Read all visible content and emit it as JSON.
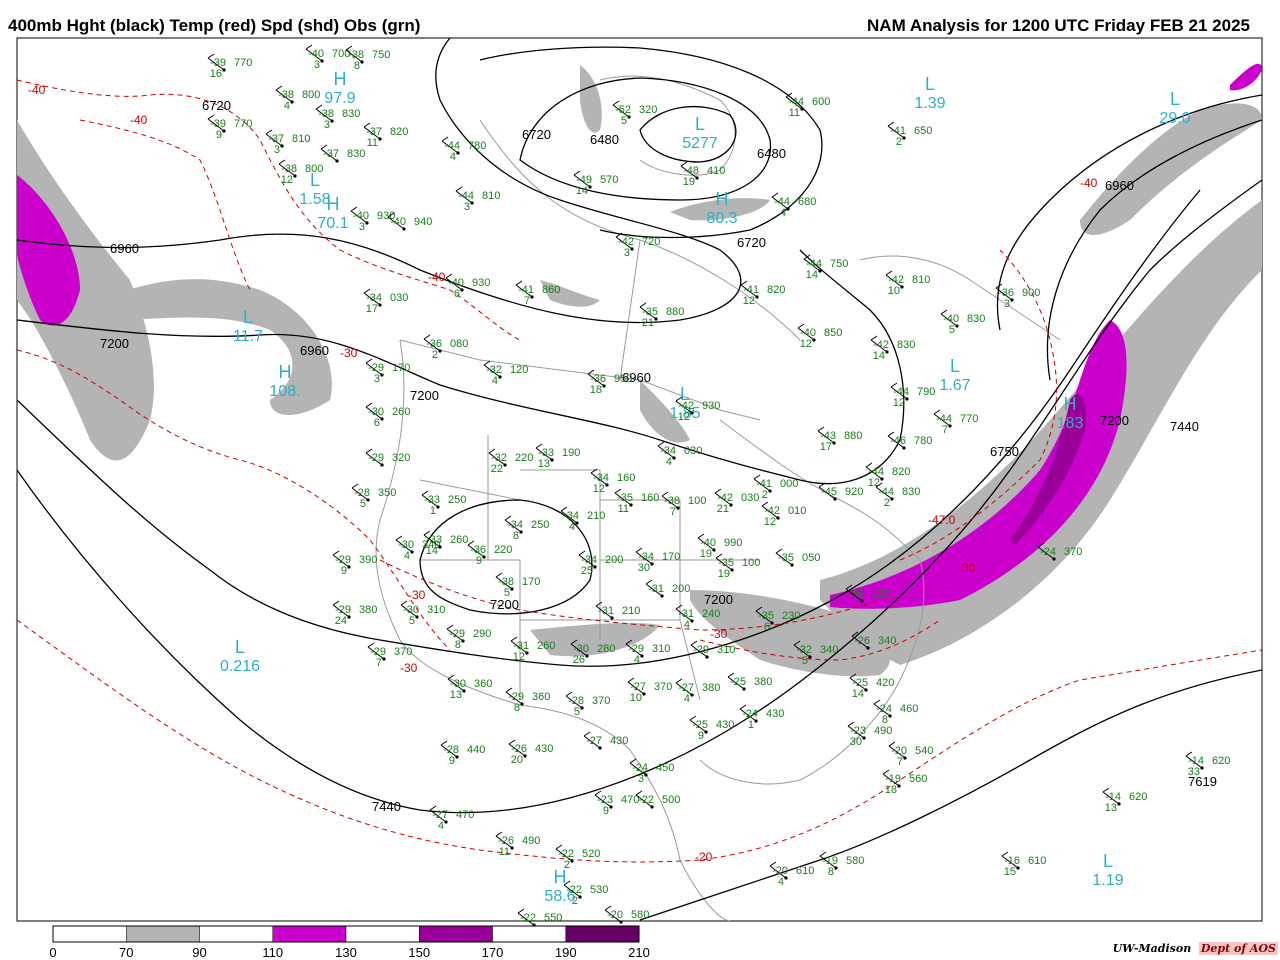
{
  "header": {
    "left": "400mb Hght (black) Temp (red) Spd (shd) Obs (grn)",
    "right": "NAM Analysis for 1200 UTC Friday  FEB 21 2025"
  },
  "legend": {
    "ticks": [
      "0",
      "70",
      "90",
      "110",
      "130",
      "150",
      "170",
      "190",
      "210"
    ],
    "colors": [
      "#ffffff",
      "#b4b4b4",
      "#ffffff",
      "#cc00cc",
      "#ffffff",
      "#990099",
      "#ffffff",
      "#660066"
    ]
  },
  "credit": {
    "text": "UW-Madison",
    "dept": "Dept of AOS"
  },
  "height_labels": [
    "6720",
    "6720",
    "6480",
    "6480",
    "6720",
    "6960",
    "6960",
    "7200",
    "6960",
    "6960",
    "7200",
    "7200",
    "7200",
    "7440",
    "7440",
    "7200",
    "6750",
    "7619"
  ],
  "temp_labels": [
    "-40",
    "-40",
    "-40",
    "-30",
    "-40",
    "-30",
    "-30",
    "-30",
    "-20",
    "-30",
    "-47.0"
  ],
  "centers": [
    {
      "letter": "H",
      "value": "97.9"
    },
    {
      "letter": "L",
      "value": "1.58"
    },
    {
      "letter": "H",
      "value": "70.1"
    },
    {
      "letter": "L",
      "value": "11.7"
    },
    {
      "letter": "H",
      "value": "108."
    },
    {
      "letter": "L",
      "value": "0.216"
    },
    {
      "letter": "H",
      "value": "80.3"
    },
    {
      "letter": "L",
      "value": "5277"
    },
    {
      "letter": "L",
      "value": "1.39"
    },
    {
      "letter": "L",
      "value": "29.0"
    },
    {
      "letter": "L",
      "value": "1.85"
    },
    {
      "letter": "H",
      "value": "183"
    },
    {
      "letter": "L",
      "value": "1.19"
    },
    {
      "letter": "H",
      "value": "58.6"
    },
    {
      "letter": "L",
      "value": "1.67"
    }
  ],
  "observations": [
    {
      "t": "-39",
      "h": "770",
      "d": "16"
    },
    {
      "t": "-40",
      "h": "700",
      "d": "3"
    },
    {
      "t": "-38",
      "h": "750",
      "d": "8"
    },
    {
      "t": "-38",
      "h": "800",
      "d": "4"
    },
    {
      "t": "-39",
      "h": "770",
      "d": "9"
    },
    {
      "t": "-38",
      "h": "830",
      "d": "3"
    },
    {
      "t": "-37",
      "h": "810",
      "d": "3"
    },
    {
      "t": "-37",
      "h": "820",
      "d": "11"
    },
    {
      "t": "-37",
      "h": "830",
      "d": ""
    },
    {
      "t": "-38",
      "h": "800",
      "d": "12"
    },
    {
      "t": "-44",
      "h": "780",
      "d": "4"
    },
    {
      "t": "-52",
      "h": "320",
      "d": "5"
    },
    {
      "t": "-49",
      "h": "570",
      "d": "14"
    },
    {
      "t": "-48",
      "h": "410",
      "d": "19"
    },
    {
      "t": "-44",
      "h": "810",
      "d": "3"
    },
    {
      "t": "-44",
      "h": "600",
      "d": "11"
    },
    {
      "t": "-41",
      "h": "650",
      "d": "2"
    },
    {
      "t": "-44",
      "h": "680",
      "d": "4"
    },
    {
      "t": "-40",
      "h": "930",
      "d": "3"
    },
    {
      "t": "-40",
      "h": "940",
      "d": ""
    },
    {
      "t": "-42",
      "h": "720",
      "d": "3"
    },
    {
      "t": "-44",
      "h": "750",
      "d": "14"
    },
    {
      "t": "-40",
      "h": "930",
      "d": "6"
    },
    {
      "t": "-41",
      "h": "860",
      "d": "7"
    },
    {
      "t": "-41",
      "h": "820",
      "d": "12"
    },
    {
      "t": "-42",
      "h": "810",
      "d": "10"
    },
    {
      "t": "-36",
      "h": "900",
      "d": "3"
    },
    {
      "t": "-34",
      "h": "030",
      "d": "17"
    },
    {
      "t": "-35",
      "h": "880",
      "d": "21"
    },
    {
      "t": "-40",
      "h": "850",
      "d": "12"
    },
    {
      "t": "-42",
      "h": "830",
      "d": "14"
    },
    {
      "t": "-40",
      "h": "830",
      "d": "5"
    },
    {
      "t": "-36",
      "h": "080",
      "d": "2"
    },
    {
      "t": "-29",
      "h": "170",
      "d": "3"
    },
    {
      "t": "-32",
      "h": "120",
      "d": "4"
    },
    {
      "t": "-36",
      "h": "950",
      "d": "18"
    },
    {
      "t": "-42",
      "h": "930",
      "d": "12"
    },
    {
      "t": "-44",
      "h": "790",
      "d": "12"
    },
    {
      "t": "-44",
      "h": "770",
      "d": "7"
    },
    {
      "t": "-30",
      "h": "260",
      "d": "6"
    },
    {
      "t": "-34",
      "h": "030",
      "d": "4"
    },
    {
      "t": "-43",
      "h": "880",
      "d": "17"
    },
    {
      "t": "-46",
      "h": "780",
      "d": ""
    },
    {
      "t": "-29",
      "h": "320",
      "d": ""
    },
    {
      "t": "-32",
      "h": "220",
      "d": "22"
    },
    {
      "t": "-33",
      "h": "190",
      "d": "13"
    },
    {
      "t": "-28",
      "h": "350",
      "d": "5"
    },
    {
      "t": "-33",
      "h": "250",
      "d": "1"
    },
    {
      "t": "-34",
      "h": "160",
      "d": "12"
    },
    {
      "t": "-35",
      "h": "160",
      "d": "11"
    },
    {
      "t": "-38",
      "h": "100",
      "d": "7"
    },
    {
      "t": "-42",
      "h": "030",
      "d": "21"
    },
    {
      "t": "-41",
      "h": "000",
      "d": "2"
    },
    {
      "t": "-44",
      "h": "820",
      "d": "12"
    },
    {
      "t": "-45",
      "h": "920",
      "d": ""
    },
    {
      "t": "-42",
      "h": "010",
      "d": "12"
    },
    {
      "t": "-44",
      "h": "830",
      "d": "2"
    },
    {
      "t": "-34",
      "h": "250",
      "d": "8"
    },
    {
      "t": "-34",
      "h": "210",
      "d": "4"
    },
    {
      "t": "-30",
      "h": "340",
      "d": "4"
    },
    {
      "t": "-33",
      "h": "260",
      "d": "14"
    },
    {
      "t": "-36",
      "h": "220",
      "d": "9"
    },
    {
      "t": "-29",
      "h": "390",
      "d": "9"
    },
    {
      "t": "-40",
      "h": "990",
      "d": "19"
    },
    {
      "t": "-35",
      "h": "100",
      "d": "19"
    },
    {
      "t": "-35",
      "h": "050",
      "d": ""
    },
    {
      "t": "-34",
      "h": "200",
      "d": "25"
    },
    {
      "t": "-34",
      "h": "170",
      "d": "30"
    },
    {
      "t": "-38",
      "h": "170",
      "d": "5"
    },
    {
      "t": "-29",
      "h": "380",
      "d": "24"
    },
    {
      "t": "-30",
      "h": "310",
      "d": "5"
    },
    {
      "t": "-31",
      "h": "200",
      "d": ""
    },
    {
      "t": "-31",
      "h": "240",
      "d": "4"
    },
    {
      "t": "-35",
      "h": "230",
      "d": "6"
    },
    {
      "t": "-30",
      "h": "130",
      "d": ""
    },
    {
      "t": "-29",
      "h": "290",
      "d": "8"
    },
    {
      "t": "-31",
      "h": "260",
      "d": "12"
    },
    {
      "t": "-31",
      "h": "210",
      "d": ""
    },
    {
      "t": "-29",
      "h": "370",
      "d": "7"
    },
    {
      "t": "-30",
      "h": "280",
      "d": "26"
    },
    {
      "t": "-29",
      "h": "310",
      "d": "4"
    },
    {
      "t": "-29",
      "h": "310",
      "d": ""
    },
    {
      "t": "-32",
      "h": "340",
      "d": "5"
    },
    {
      "t": "-26",
      "h": "340",
      "d": ""
    },
    {
      "t": "-30",
      "h": "360",
      "d": "13"
    },
    {
      "t": "-29",
      "h": "360",
      "d": "8"
    },
    {
      "t": "-28",
      "h": "370",
      "d": "5"
    },
    {
      "t": "-27",
      "h": "370",
      "d": "10"
    },
    {
      "t": "-27",
      "h": "380",
      "d": "4"
    },
    {
      "t": "-25",
      "h": "380",
      "d": ""
    },
    {
      "t": "-25",
      "h": "420",
      "d": "14"
    },
    {
      "t": "-25",
      "h": "430",
      "d": "9"
    },
    {
      "t": "-24",
      "h": "430",
      "d": "1"
    },
    {
      "t": "-24",
      "h": "460",
      "d": "8"
    },
    {
      "t": "-23",
      "h": "490",
      "d": "30"
    },
    {
      "t": "-24",
      "h": "370",
      "d": ""
    },
    {
      "t": "-28",
      "h": "440",
      "d": "9"
    },
    {
      "t": "-26",
      "h": "430",
      "d": "20"
    },
    {
      "t": "-27",
      "h": "430",
      "d": ""
    },
    {
      "t": "-24",
      "h": "450",
      "d": "3"
    },
    {
      "t": "-20",
      "h": "540",
      "d": "7"
    },
    {
      "t": "-19",
      "h": "560",
      "d": "18"
    },
    {
      "t": "-23",
      "h": "470",
      "d": "9"
    },
    {
      "t": "-22",
      "h": "500",
      "d": ""
    },
    {
      "t": "-27",
      "h": "470",
      "d": "4"
    },
    {
      "t": "-26",
      "h": "490",
      "d": "11"
    },
    {
      "t": "-22",
      "h": "520",
      "d": "2"
    },
    {
      "t": "-22",
      "h": "530",
      "d": "2"
    },
    {
      "t": "-22",
      "h": "550",
      "d": ""
    },
    {
      "t": "-20",
      "h": "580",
      "d": ""
    },
    {
      "t": "-20",
      "h": "610",
      "d": "4"
    },
    {
      "t": "-19",
      "h": "580",
      "d": "8"
    },
    {
      "t": "-16",
      "h": "610",
      "d": "15"
    },
    {
      "t": "-14",
      "h": "620",
      "d": "33"
    },
    {
      "t": "-14",
      "h": "620",
      "d": "13"
    }
  ]
}
